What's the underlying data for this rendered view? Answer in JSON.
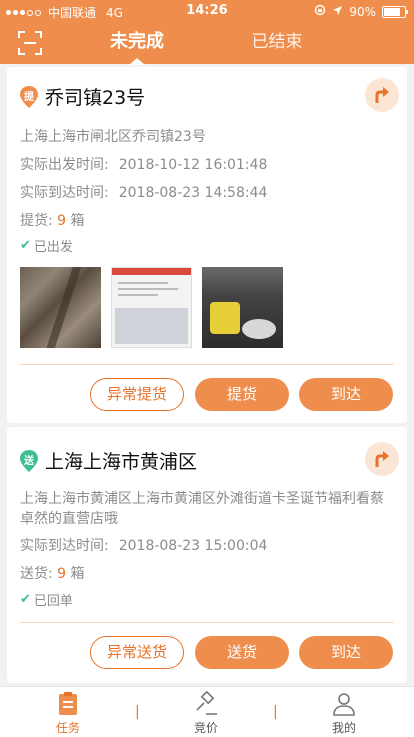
{
  "status_bar": {
    "carrier": "中国联通",
    "network": "4G",
    "time": "14:26",
    "battery": "90%",
    "battery_level": 0.9
  },
  "header": {
    "tabs": [
      {
        "label": "未完成",
        "active": true
      },
      {
        "label": "已结束",
        "active": false
      }
    ]
  },
  "cards": [
    {
      "badge": "提",
      "badge_color": "#ef8d4c",
      "title": "乔司镇23号",
      "address": "上海上海市闸北区乔司镇23号",
      "depart_label": "实际出发时间:",
      "depart_time": "2018-10-12 16:01:48",
      "arrive_label": "实际到达时间:",
      "arrive_time": "2018-08-23 14:58:44",
      "qty_label": "提货:",
      "qty_value": "9",
      "qty_unit": "箱",
      "status": "已出发",
      "buttons": [
        "异常提货",
        "提货",
        "到达"
      ]
    },
    {
      "badge": "送",
      "badge_color": "#3fbf8f",
      "title": "上海上海市黄浦区",
      "address": "上海上海市黄浦区上海市黄浦区外滩街道卡圣诞节福利看蔡卓然的直营店哦",
      "arrive_label": "实际到达时间:",
      "arrive_time": "2018-08-23 15:00:04",
      "qty_label": "送货:",
      "qty_value": "9",
      "qty_unit": "箱",
      "status": "已回单",
      "buttons": [
        "异常送货",
        "送货",
        "到达"
      ]
    }
  ],
  "tabbar": {
    "items": [
      {
        "label": "任务",
        "active": true
      },
      {
        "label": "竞价",
        "active": false
      },
      {
        "label": "我的",
        "active": false
      }
    ],
    "separator": "|"
  },
  "colors": {
    "primary": "#ef8d4c",
    "accent_text": "#e8722a",
    "success": "#3fbf8f"
  }
}
